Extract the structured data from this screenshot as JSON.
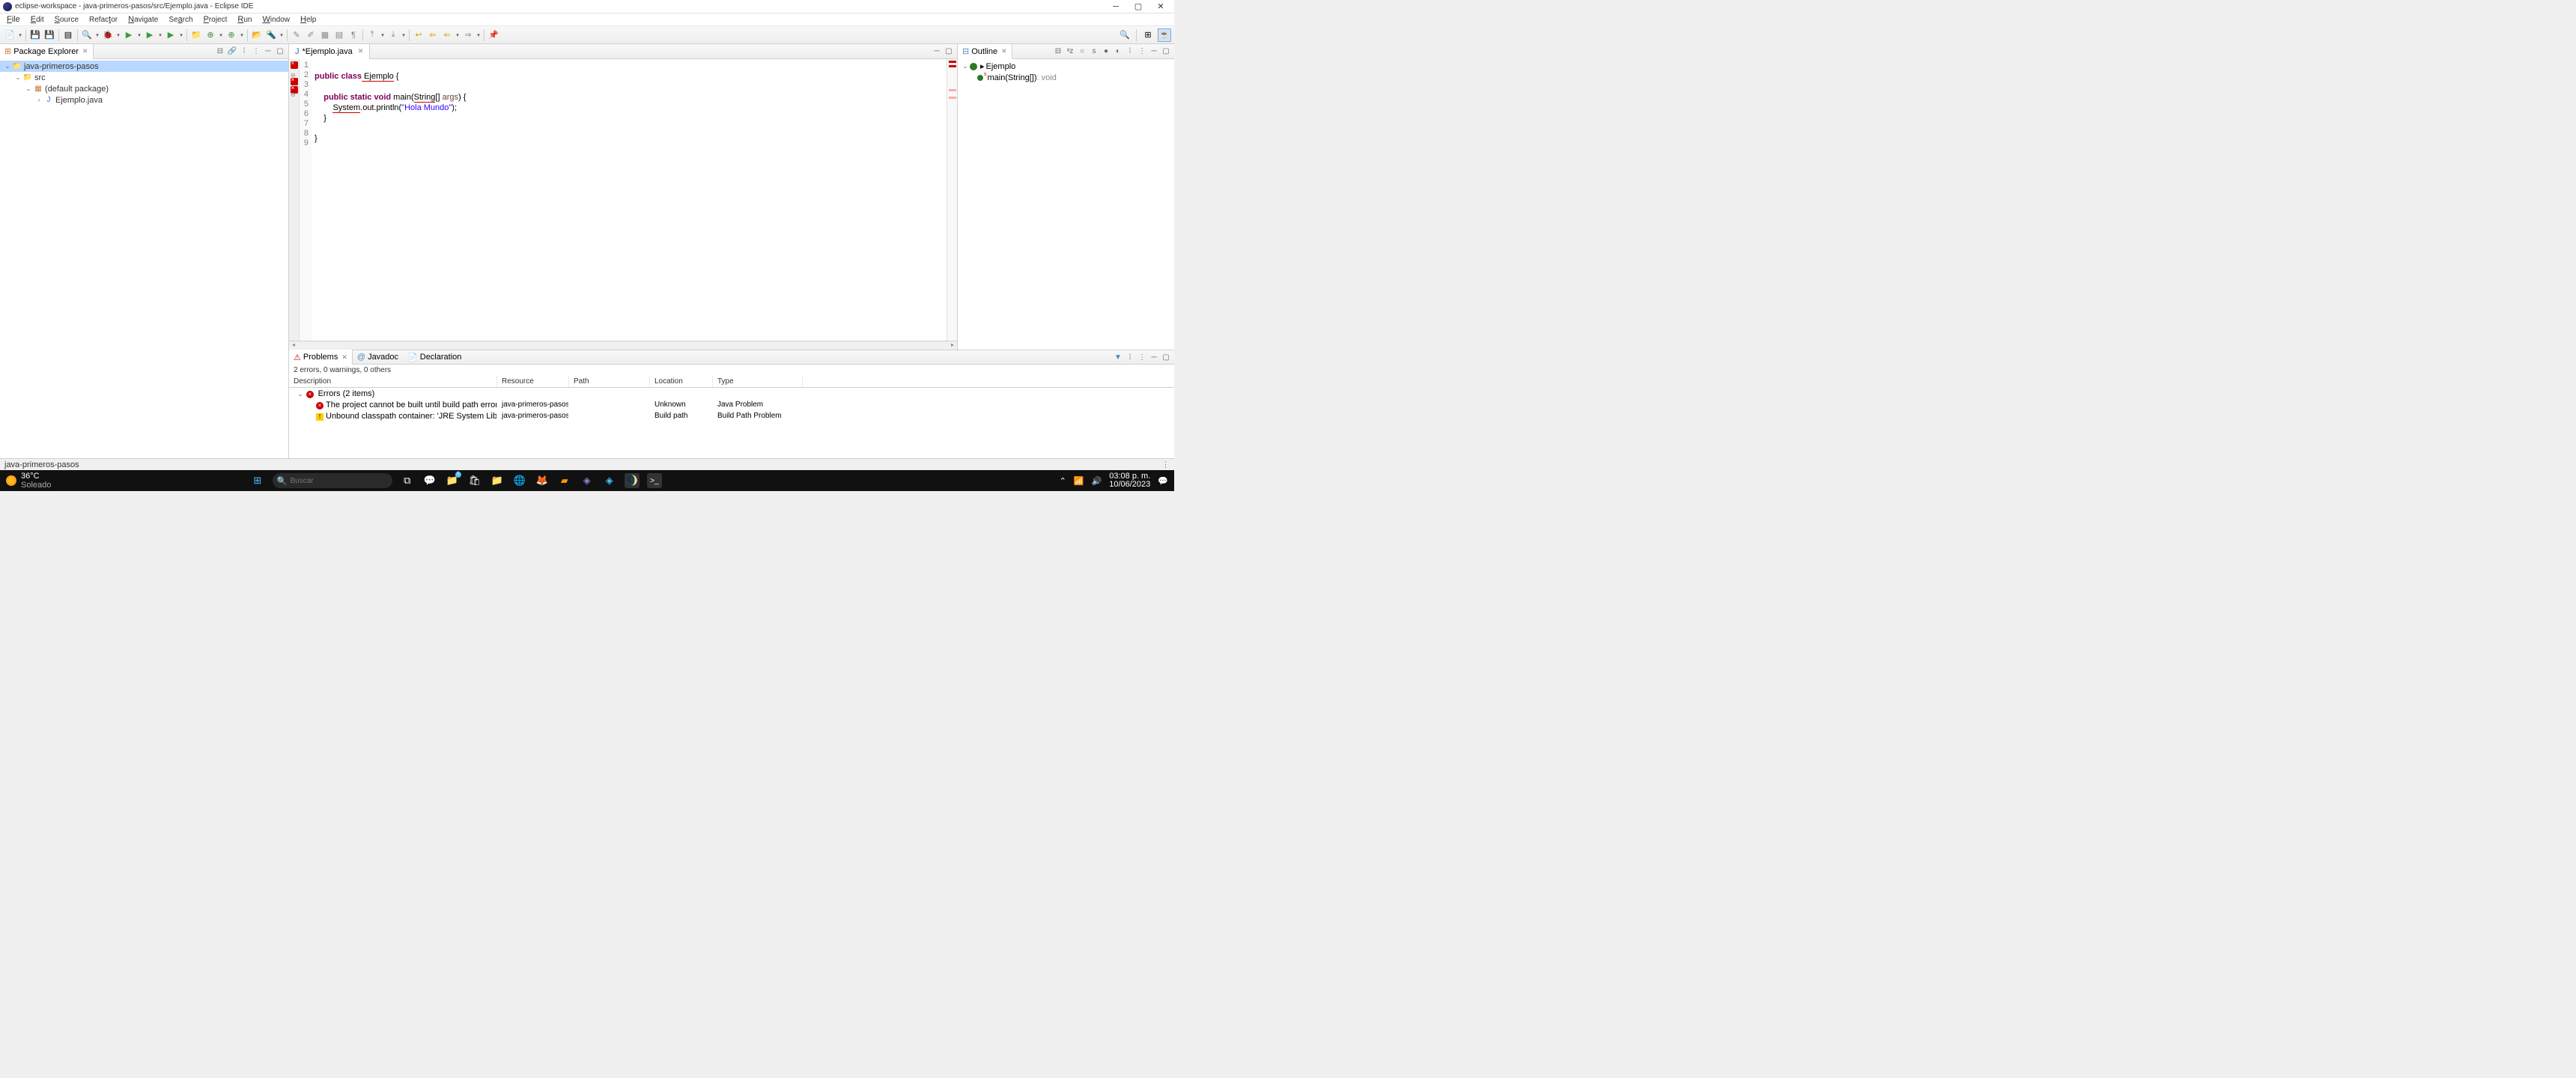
{
  "window": {
    "title": "eclipse-workspace - java-primeros-pasos/src/Ejemplo.java - Eclipse IDE"
  },
  "menubar": {
    "items": [
      "File",
      "Edit",
      "Source",
      "Refactor",
      "Navigate",
      "Search",
      "Project",
      "Run",
      "Window",
      "Help"
    ]
  },
  "views": {
    "package_explorer": {
      "title": "Package Explorer",
      "tree": {
        "project": "java-primeros-pasos",
        "src": "src",
        "default_pkg": "(default package)",
        "file": "Ejemplo.java"
      }
    },
    "outline": {
      "title": "Outline",
      "root": "Ejemplo",
      "method": "main(String[])",
      "method_return": " : void"
    }
  },
  "editor": {
    "tab_title": "*Ejemplo.java",
    "lines": {
      "l1": "",
      "l2_a": "public",
      "l2_b": " class",
      "l2_c": " Ejemplo",
      "l2_d": " {",
      "l3": "",
      "l4_a": "    public",
      "l4_b": " static",
      "l4_c": " void",
      "l4_d": " main(",
      "l4_e": "String",
      "l4_f": "[] ",
      "l4_g": "args",
      "l4_h": ") {",
      "l5_a": "        ",
      "l5_b": "System",
      "l5_c": ".out.println(",
      "l5_d": "\"Hola Mundo\"",
      "l5_e": ");",
      "l6": "    }",
      "l7": "",
      "l8": "}",
      "l9": ""
    },
    "line_numbers": [
      "1",
      "2",
      "3",
      "4",
      "5",
      "6",
      "7",
      "8",
      "9"
    ]
  },
  "problems": {
    "tab_problems": "Problems",
    "tab_javadoc": "Javadoc",
    "tab_declaration": "Declaration",
    "summary": "2 errors, 0 warnings, 0 others",
    "columns": {
      "description": "Description",
      "resource": "Resource",
      "path": "Path",
      "location": "Location",
      "type": "Type"
    },
    "group": "Errors (2 items)",
    "rows": [
      {
        "desc": "The project cannot be built until build path errors are ",
        "resource": "java-primeros-pasos",
        "path": "",
        "location": "Unknown",
        "type": "Java Problem",
        "icon": "error"
      },
      {
        "desc": "Unbound classpath container: 'JRE System Library [Jav",
        "resource": "java-primeros-pasos",
        "path": "",
        "location": "Build path",
        "type": "Build Path Problem",
        "icon": "warning"
      }
    ]
  },
  "statusbar": {
    "text": "java-primeros-pasos"
  },
  "taskbar": {
    "weather_temp": "36°C",
    "weather_desc": "Soleado",
    "search_placeholder": "Buscar",
    "time": "03:08 p. m.",
    "date": "10/06/2023"
  }
}
